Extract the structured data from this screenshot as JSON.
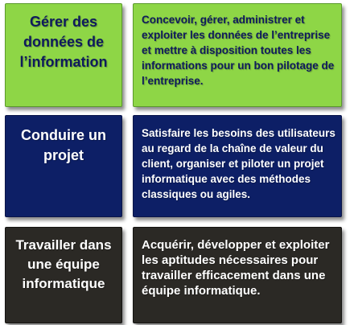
{
  "colors": {
    "green_fill": "#8ed646",
    "green_border": "#5b9a2b",
    "green_text": "#0f1b5c",
    "navy_fill": "#0d1f66",
    "navy_border": "#0a1448",
    "navy_text": "#ffffff",
    "dark_fill": "#2b2925",
    "dark_border": "#151412",
    "dark_text": "#ffffff"
  },
  "rows": [
    {
      "label": "Gérer des données de l’information",
      "description": "Concevoir, gérer, administrer et exploiter les données de l’entreprise et mettre à disposition toutes les informations pour un bon pilotage de l’entreprise."
    },
    {
      "label": "Conduire un projet",
      "description": "Satisfaire les besoins des utilisateurs au regard de la chaîne de valeur du client, organiser et piloter un projet informatique avec des méthodes classiques ou agiles."
    },
    {
      "label": "Travailler dans une équipe informatique",
      "description": "Acquérir, développer et exploiter les aptitudes nécessaires pour travailler efficacement dans une équipe informatique."
    }
  ]
}
